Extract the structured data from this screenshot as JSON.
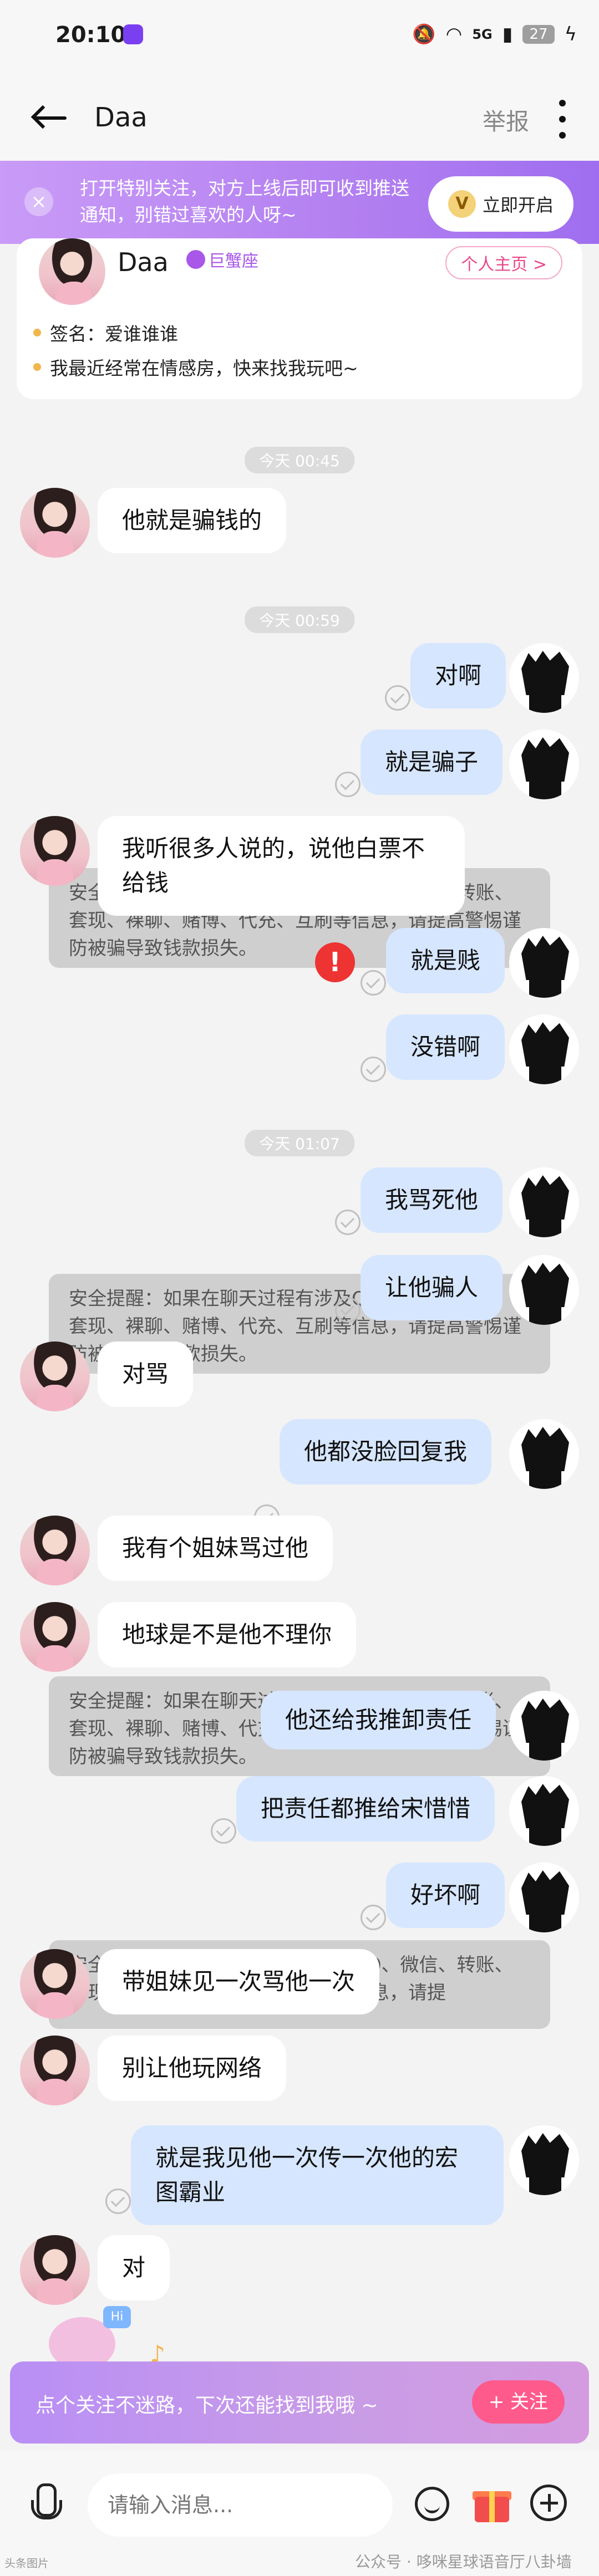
{
  "status_bar": {
    "time": "20:10",
    "battery": "27",
    "network": "5G"
  },
  "header": {
    "title": "Daa",
    "report": "举报"
  },
  "notice": {
    "text": "打开特别关注，对方上线后即可收到推送通知，别错过喜欢的人呀~",
    "button": "立即开启",
    "badge": "V"
  },
  "profile": {
    "name": "Daa",
    "zodiac": "巨蟹座",
    "home_button": "个人主页 >",
    "signature": "签名：爱谁谁谁",
    "room": "我最近经常在情感房，快来找我玩吧~"
  },
  "timestamps": [
    "今天 00:45",
    "今天 00:59",
    "今天 01:07"
  ],
  "messages": [
    {
      "side": "left",
      "text": "他就是骗钱的"
    },
    {
      "side": "right",
      "text": "对啊"
    },
    {
      "side": "right",
      "text": "就是骗子"
    },
    {
      "side": "left",
      "text": "我听很多人说的，说他白票不给钱"
    },
    {
      "side": "right",
      "text": "就是贱"
    },
    {
      "side": "right",
      "text": "没错啊"
    },
    {
      "side": "right",
      "text": "我骂死他"
    },
    {
      "side": "right",
      "text": "让他骗人"
    },
    {
      "side": "left",
      "text": "对骂"
    },
    {
      "side": "right",
      "text": "他都没脸回复我"
    },
    {
      "side": "left",
      "text": "我有个姐妹骂过他"
    },
    {
      "side": "left",
      "text": "地球是不是他不理你"
    },
    {
      "side": "right",
      "text": "他还给我推卸责任"
    },
    {
      "side": "right",
      "text": "把责任都推给宋惜惜"
    },
    {
      "side": "right",
      "text": "好坏啊"
    },
    {
      "side": "left",
      "text": "带姐妹见一次骂他一次"
    },
    {
      "side": "left",
      "text": "别让他玩网络"
    },
    {
      "side": "right",
      "text": "就是我见他一次传一次他的宏图霸业"
    },
    {
      "side": "left",
      "text": "对"
    }
  ],
  "safety": [
    "安全提醒：如果在聊天过程有涉及QQ、微信、转账、套现、裸聊、赌博、代充、互刷等信息，请提高警惕谨防被骗导致钱款损失。",
    "安全提醒：如果在聊天过程有涉及QQ、微信、转账、套现、裸聊、赌博、代充、互刷等信息，请提高警惕谨防被骗导致钱款损失。",
    "安全提醒：如果在聊天过程有涉及QQ、微信、转账、套现、裸聊、赌博、代充、互刷等信息，请提高警惕谨防被骗导致钱款损失。",
    "安全提醒：如果在聊天过程有涉及QQ、微信、转账、套现、裸聊、赌博、代充、互刷等信息，请提"
  ],
  "follow_bar": {
    "text": "点个关注不迷路，下次还能找到我哦 ~",
    "button": "+ 关注",
    "mascot_label": "Hi"
  },
  "input": {
    "placeholder": "请输入消息..."
  },
  "watermark": {
    "left": "头条图片",
    "right": "公众号 · 哆咪星球语音厅八卦墙"
  }
}
